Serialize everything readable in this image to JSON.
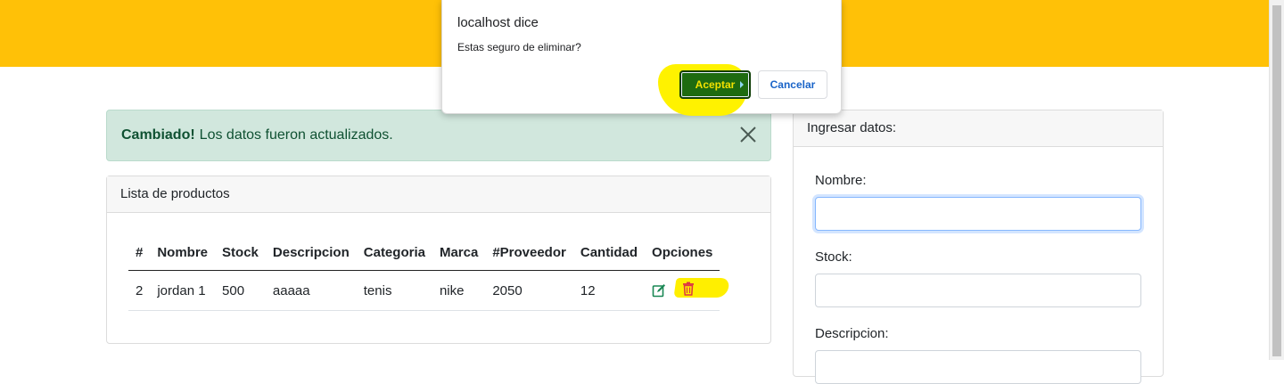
{
  "dialog": {
    "title": "localhost dice",
    "message": "Estas seguro de eliminar?",
    "accept_label": "Aceptar",
    "cancel_label": "Cancelar"
  },
  "alert": {
    "strong": "Cambiado!",
    "text": "Los datos fueron actualizados."
  },
  "products": {
    "header": "Lista de productos",
    "columns": [
      "#",
      "Nombre",
      "Stock",
      "Descripcion",
      "Categoria",
      "Marca",
      "#Proveedor",
      "Cantidad",
      "Opciones"
    ],
    "rows": [
      [
        "2",
        "jordan 1",
        "500",
        "aaaaa",
        "tenis",
        "nike",
        "2050",
        "12"
      ]
    ]
  },
  "form": {
    "header": "Ingresar datos:",
    "nombre_label": "Nombre:",
    "stock_label": "Stock:",
    "descripcion_label": "Descripcion:"
  },
  "colors": {
    "topbar": "#ffc107",
    "alert_bg": "#d1e7dd",
    "accept_button": "#1e6b10",
    "highlight": "#fff200",
    "edit_icon": "#198754",
    "delete_icon": "#dc3545"
  },
  "icons": {
    "close": "close-icon",
    "edit": "edit-icon",
    "delete": "trash-icon"
  }
}
